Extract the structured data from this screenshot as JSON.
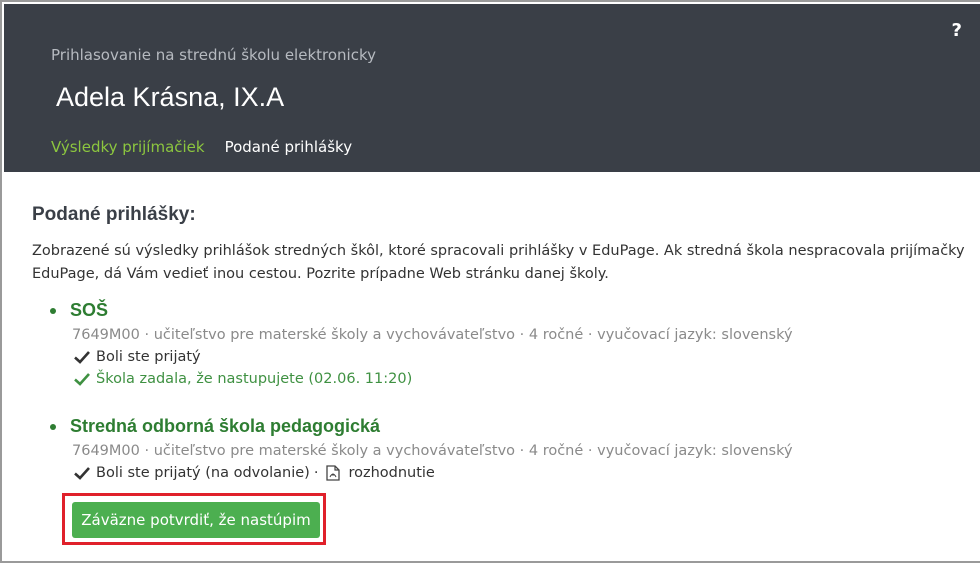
{
  "header": {
    "subtitle": "Prihlasovanie na strednú školu elektronicky",
    "student_name": "Adela Krásna, IX.A",
    "help_label": "?",
    "tabs": [
      {
        "label": "Výsledky prijímačiek",
        "active": true
      },
      {
        "label": "Podané prihlášky",
        "active": false
      }
    ]
  },
  "content": {
    "section_title": "Podané prihlášky:",
    "intro_line1": "Zobrazené sú výsledky prihlášok stredných škôl, ktoré spracovali prihlášky v EduPage. Ak stredná škola nespracovala prijímačky",
    "intro_line2": "EduPage, dá Vám vedieť inou cestou. Pozrite prípadne Web stránku danej školy.",
    "schools": [
      {
        "name": "SOŠ",
        "info": "7649M00 · učiteľstvo pre materské školy a vychovávateľstvo · 4 ročné · vyučovací jazyk: slovenský",
        "statuses": [
          {
            "text": "Boli ste prijatý",
            "color": "#333333"
          },
          {
            "text": "Škola zadala, že nastupujete (02.06.  11:20)",
            "color": "#3f9142"
          }
        ]
      },
      {
        "name": "Stredná odborná škola pedagogická",
        "info": "7649M00 · učiteľstvo pre materské školy a vychovávateľstvo · 4 ročné · vyučovací jazyk: slovenský",
        "statuses": [
          {
            "text": "Boli ste prijatý (na odvolanie)",
            "color": "#333333"
          }
        ],
        "separator": "·",
        "document_label": "rozhodnutie",
        "confirm_button": "Záväzne potvrdiť, že nastúpim"
      }
    ]
  },
  "colors": {
    "header_bg": "#3a3f47",
    "accent_green": "#8cc63f",
    "school_green": "#2e7d32",
    "button_green": "#4caf50",
    "highlight_red": "#e0202a"
  }
}
